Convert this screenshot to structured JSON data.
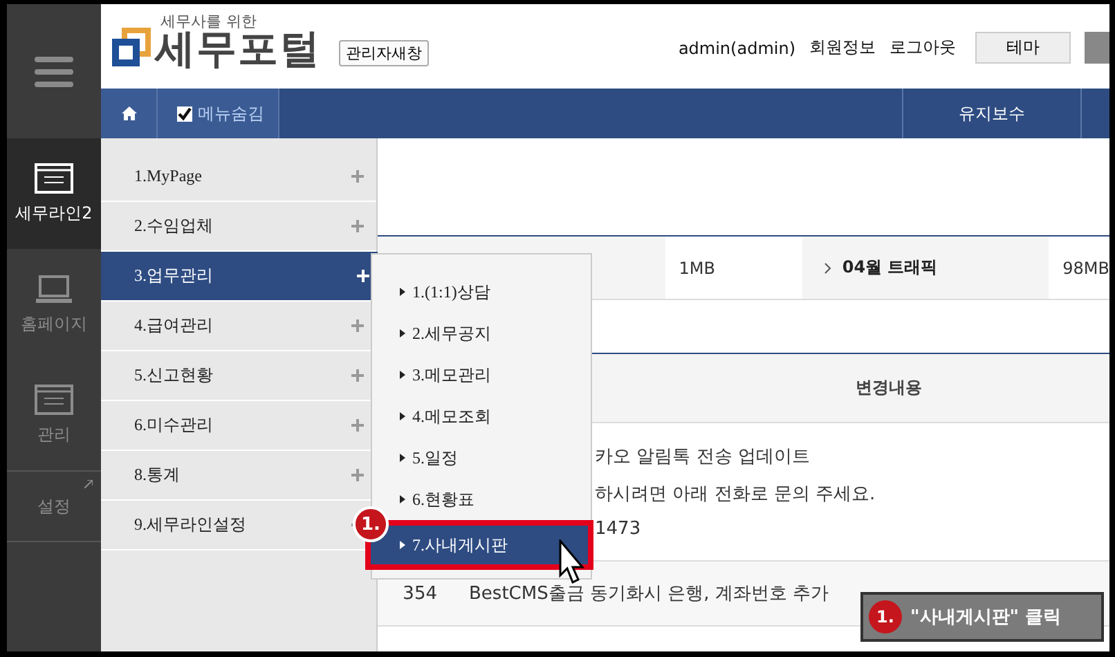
{
  "header": {
    "logo_tagline": "세무사를 위한",
    "logo_title": "세무포털",
    "admin_window_button": "관리자새창",
    "user": "admin(admin)",
    "links": [
      "회원정보",
      "로그아웃"
    ],
    "theme_button": "테마"
  },
  "navbar": {
    "menu_hide": {
      "label": "메뉴숨김",
      "checked": true
    },
    "tabs": [
      {
        "label": "유지보수",
        "selected": false
      }
    ]
  },
  "rail": [
    {
      "label": "세무라인2",
      "kind": "window",
      "selected": true
    },
    {
      "label": "홈페이지",
      "kind": "laptop",
      "selected": false
    },
    {
      "label": "관리",
      "kind": "window",
      "selected": false
    },
    {
      "label": "설정",
      "kind": "link",
      "selected": false
    }
  ],
  "menu": [
    {
      "label": "1.MyPage",
      "selected": false
    },
    {
      "label": "2.수임업체",
      "selected": false
    },
    {
      "label": "3.업무관리",
      "selected": true
    },
    {
      "label": "4.급여관리",
      "selected": false
    },
    {
      "label": "5.신고현황",
      "selected": false
    },
    {
      "label": "6.미수관리",
      "selected": false
    },
    {
      "label": "8.통계",
      "selected": false
    },
    {
      "label": "9.세무라인설정",
      "selected": false
    }
  ],
  "submenu": [
    {
      "label": "1.(1:1)상담",
      "selected": false
    },
    {
      "label": "2.세무공지",
      "selected": false
    },
    {
      "label": "3.메모관리",
      "selected": false
    },
    {
      "label": "4.메모조회",
      "selected": false
    },
    {
      "label": "5.일정",
      "selected": false
    },
    {
      "label": "6.현황표",
      "selected": false
    },
    {
      "label": "7.사내게시판",
      "selected": true
    }
  ],
  "content": {
    "usage": "1MB",
    "traffic_label": "04월 트래픽",
    "traffic_value": "98MB",
    "changes_header": "변경내용",
    "notice_lines": [
      "카오 알림톡 전송 업데이트",
      "하시려면 아래 전화로 문의 주세요.",
      "1473"
    ],
    "rows": [
      {
        "column_1": "354",
        "column_2": "BestCMS출금 동기화시 은행, 계좌번호 추가"
      }
    ]
  },
  "annotation": {
    "badge": "1.",
    "callout_badge": "1.",
    "callout_text": "\"사내게시판\" 클릭"
  }
}
